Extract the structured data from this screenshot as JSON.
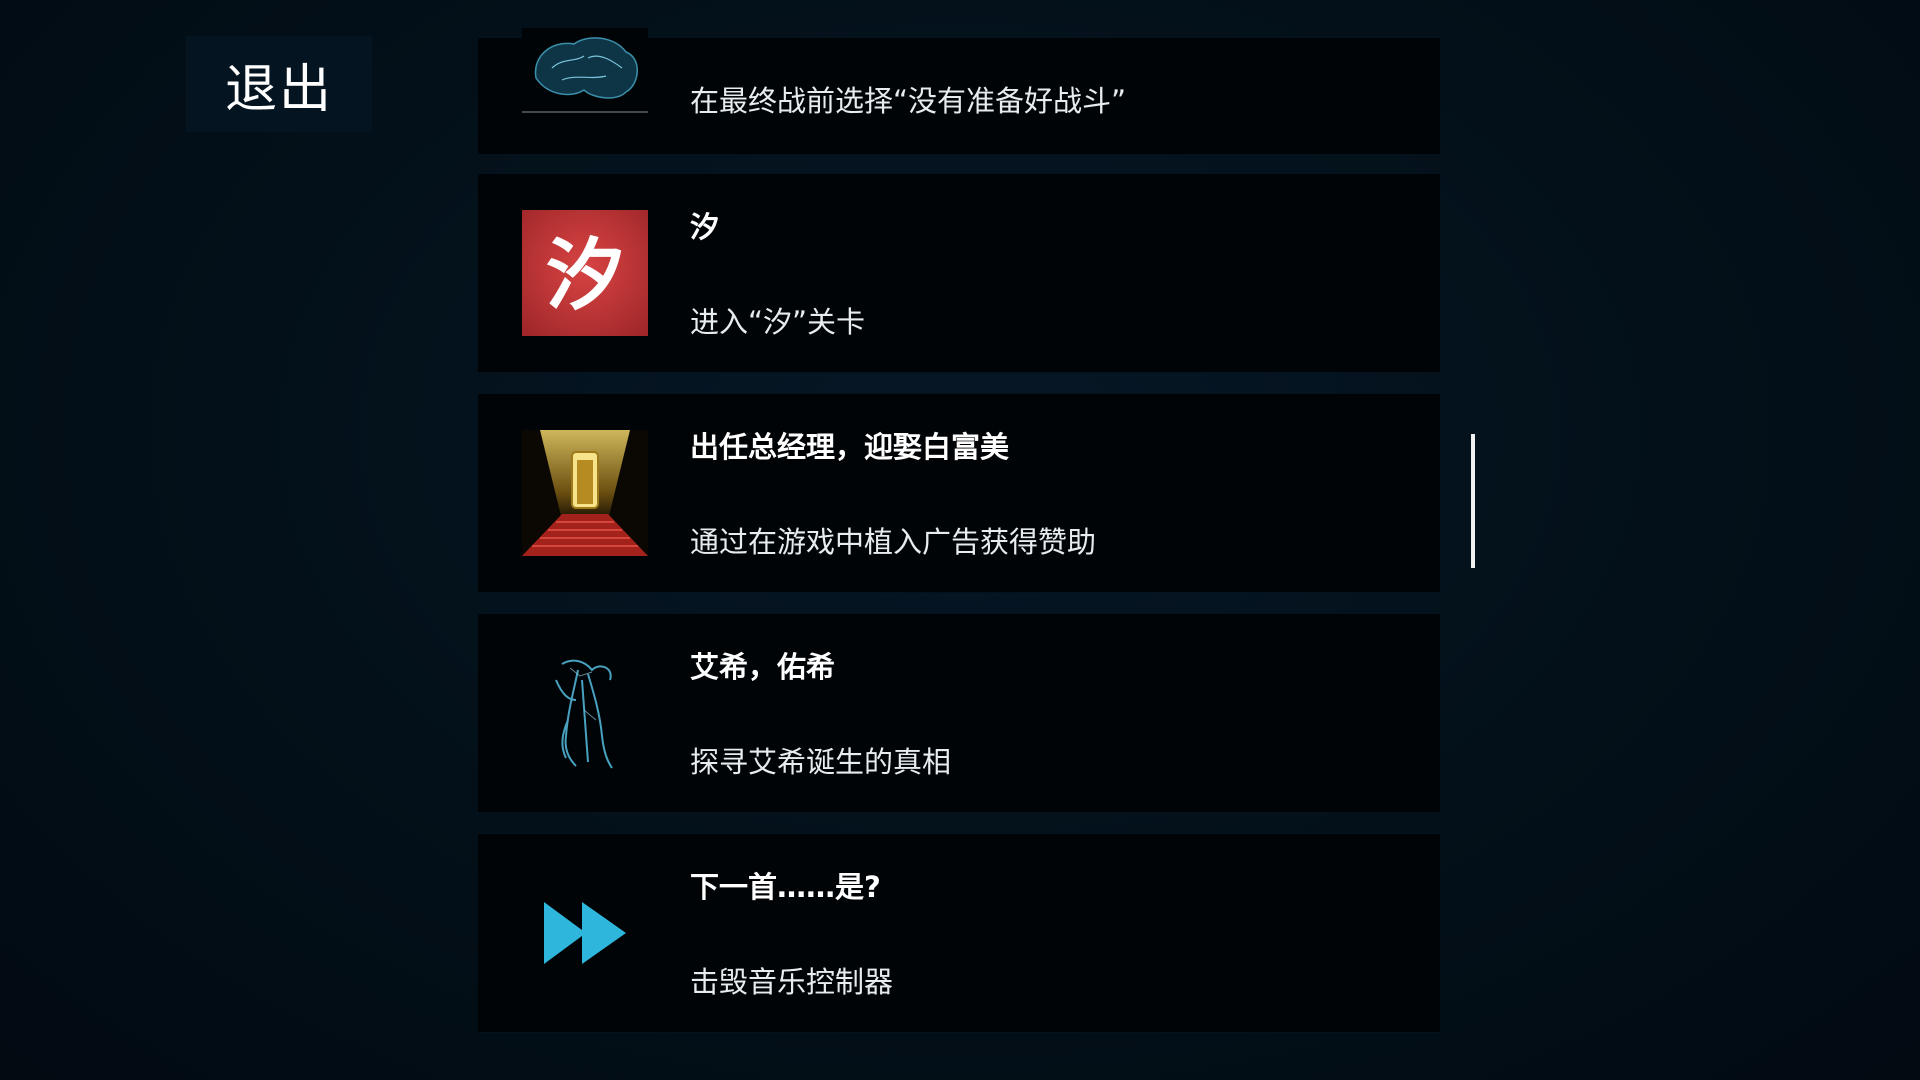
{
  "header": {
    "exit_label": "退出"
  },
  "achievements": [
    {
      "title": "",
      "description": "在最终战前选择“没有准备好战斗”",
      "icon": "brain-hologram-icon"
    },
    {
      "title": "汐",
      "description": "进入“汐”关卡",
      "icon": "xi-character-icon",
      "icon_text": "汐"
    },
    {
      "title": "出任总经理，迎娶白富美",
      "description": "通过在游戏中植入广告获得赞助",
      "icon": "golden-doorway-red-stairs-icon"
    },
    {
      "title": "艾希，佑希",
      "description": "探寻艾希诞生的真相",
      "icon": "hologram-figure-icon"
    },
    {
      "title": "下一首……是?",
      "description": "击毁音乐控制器",
      "icon": "fast-forward-icon"
    }
  ],
  "colors": {
    "background": "#030d17",
    "card": "#010407",
    "xi_icon_red": "#c8383a",
    "fast_forward_cyan": "#2fb6dc",
    "gold": "#d9b94a"
  }
}
